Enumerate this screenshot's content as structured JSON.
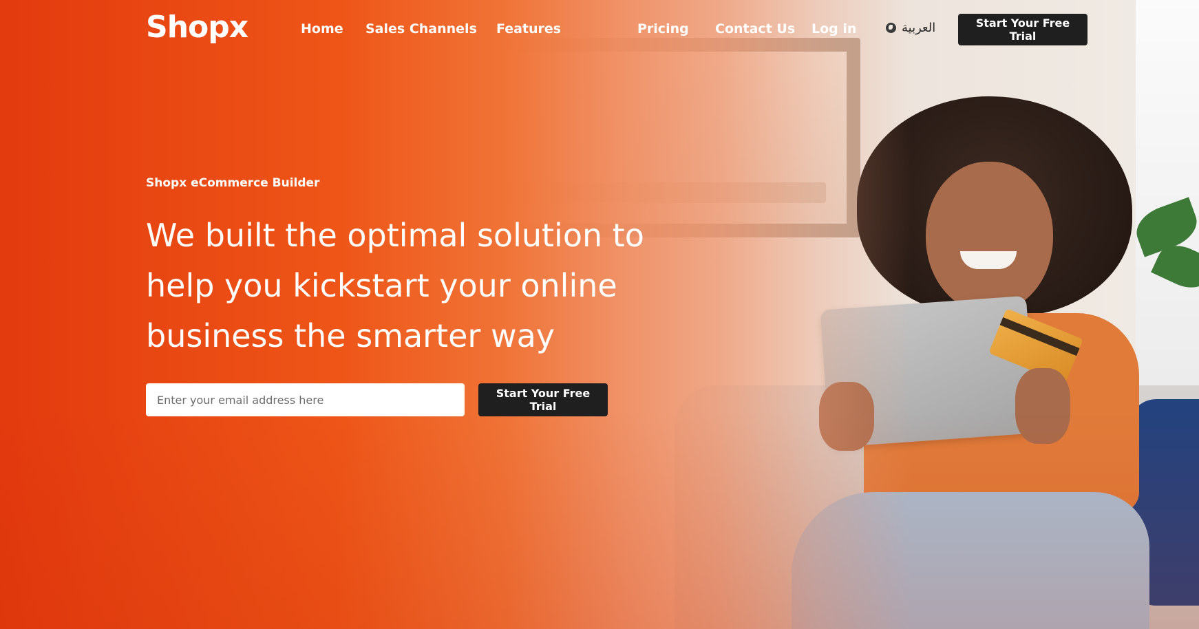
{
  "header": {
    "logo_text": "Shopx",
    "nav": {
      "home": "Home",
      "sales_channels": "Sales Channels",
      "features": "Features",
      "pricing": "Pricing",
      "contact_us": "Contact Us",
      "log_in": "Log in"
    },
    "language_label": "العربية",
    "language_icon": "globe-icon",
    "cta_label": "Start Your Free Trial"
  },
  "hero": {
    "eyebrow": "Shopx eCommerce Builder",
    "headline": "We built the optimal solution to help you kickstart your online business the smarter way",
    "email_placeholder": "Enter your email address here",
    "cta_label": "Start Your Free Trial"
  },
  "colors": {
    "brand_orange": "#ee5517",
    "button_dark": "#1f1f1f",
    "text_light": "#ffffff"
  }
}
